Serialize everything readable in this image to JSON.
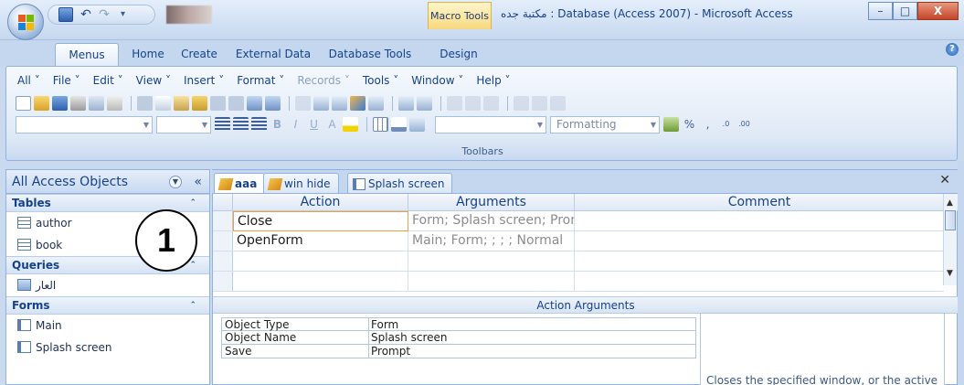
{
  "app": {
    "window_title": "مكتبة جده : Database (Access 2007) - Microsoft Access",
    "contextual_tab": "Macro Tools"
  },
  "window_controls": {
    "minimize": "–",
    "maximize": "□",
    "close": "X"
  },
  "ribbon_tabs": [
    "Menus",
    "Home",
    "Create",
    "External Data",
    "Database Tools",
    "Design"
  ],
  "active_ribbon_tab": "Menus",
  "menubar": [
    "All ˅",
    "File ˅",
    "Edit ˅",
    "View ˅",
    "Insert ˅",
    "Format ˅",
    "Records ˅",
    "Tools ˅",
    "Window ˅",
    "Help ˅"
  ],
  "toolbar": {
    "style_combo": "Formatting",
    "group_label": "Toolbars"
  },
  "nav_pane": {
    "title": "All Access Objects",
    "groups": [
      {
        "label": "Tables",
        "items": [
          "author",
          "book"
        ]
      },
      {
        "label": "Queries",
        "items": [
          "العار"
        ]
      },
      {
        "label": "Forms",
        "items": [
          "Main",
          "Splash screen"
        ]
      }
    ]
  },
  "callout_number": "1",
  "document_tabs": [
    {
      "label": "aaa",
      "icon": "macro-icon",
      "selected": true
    },
    {
      "label": "win hide",
      "icon": "macro-icon",
      "selected": false
    },
    {
      "label": "Splash screen",
      "icon": "form-icon",
      "selected": false
    }
  ],
  "macro_grid": {
    "columns": [
      "Action",
      "Arguments",
      "Comment"
    ],
    "rows": [
      {
        "action": "Close",
        "arguments": "Form; Splash screen; Prompt",
        "comment": ""
      },
      {
        "action": "OpenForm",
        "arguments": "Main; Form; ; ; ; Normal",
        "comment": ""
      },
      {
        "action": "",
        "arguments": "",
        "comment": ""
      },
      {
        "action": "",
        "arguments": "",
        "comment": ""
      }
    ]
  },
  "action_arguments": {
    "title": "Action Arguments",
    "rows": [
      {
        "label": "Object Type",
        "value": "Form"
      },
      {
        "label": "Object Name",
        "value": "Splash screen"
      },
      {
        "label": "Save",
        "value": "Prompt"
      }
    ],
    "description": "Closes the specified window, or the active"
  },
  "colors": {
    "ribbon_blue": "#c4d7ef",
    "accent_orange": "#e9a23d",
    "text_blue": "#15428b"
  }
}
